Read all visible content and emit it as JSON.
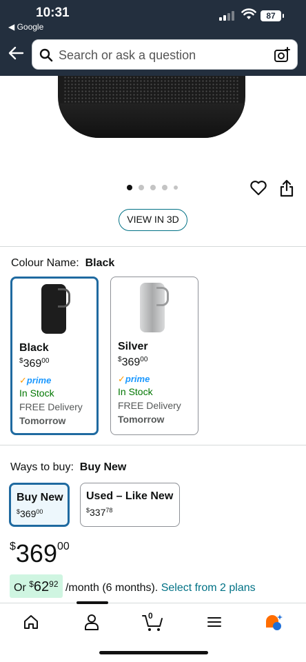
{
  "status_bar": {
    "time": "10:31",
    "back_app": "◀ Google",
    "battery": "87"
  },
  "search": {
    "placeholder": "Search or ask a question"
  },
  "gallery": {
    "image_count": 5,
    "active_index": 0,
    "view_3d_label": "VIEW IN 3D"
  },
  "colour": {
    "label": "Colour Name:",
    "selected": "Black",
    "options": [
      {
        "name": "Black",
        "price_dollar": "$",
        "price_main": "369",
        "price_cents": "00",
        "prime": "prime",
        "stock": "In Stock",
        "delivery": "FREE Delivery",
        "delivery_day": "Tomorrow",
        "swatch_color": "#1d1d1d"
      },
      {
        "name": "Silver",
        "price_dollar": "$",
        "price_main": "369",
        "price_cents": "00",
        "prime": "prime",
        "stock": "In Stock",
        "delivery": "FREE Delivery",
        "delivery_day": "Tomorrow",
        "swatch_color": "#c9cacb"
      }
    ]
  },
  "ways_to_buy": {
    "label": "Ways to buy:",
    "selected": "Buy New",
    "options": [
      {
        "title": "Buy New",
        "price_dollar": "$",
        "price_main": "369",
        "price_cents": "00"
      },
      {
        "title": "Used – Like New",
        "price_dollar": "$",
        "price_main": "337",
        "price_cents": "78"
      }
    ]
  },
  "price": {
    "currency": "$",
    "main": "369",
    "cents": "00"
  },
  "monthly": {
    "prefix": "Or ",
    "currency": "$",
    "amount": "62",
    "cents": "92",
    "suffix": " /month (6 months). ",
    "link": "Select from 2 plans"
  },
  "bottom_nav": {
    "items": [
      "home-icon",
      "account-icon",
      "cart-icon",
      "menu-icon",
      "rufus-assistant-icon"
    ],
    "cart_count": "0"
  },
  "colors": {
    "header_bg": "#232f3e",
    "selected_border": "#1f6aa0",
    "link": "#007185",
    "in_stock": "#007600",
    "prime_blue": "#1a98ff",
    "monthly_highlight": "#cff5e1"
  }
}
